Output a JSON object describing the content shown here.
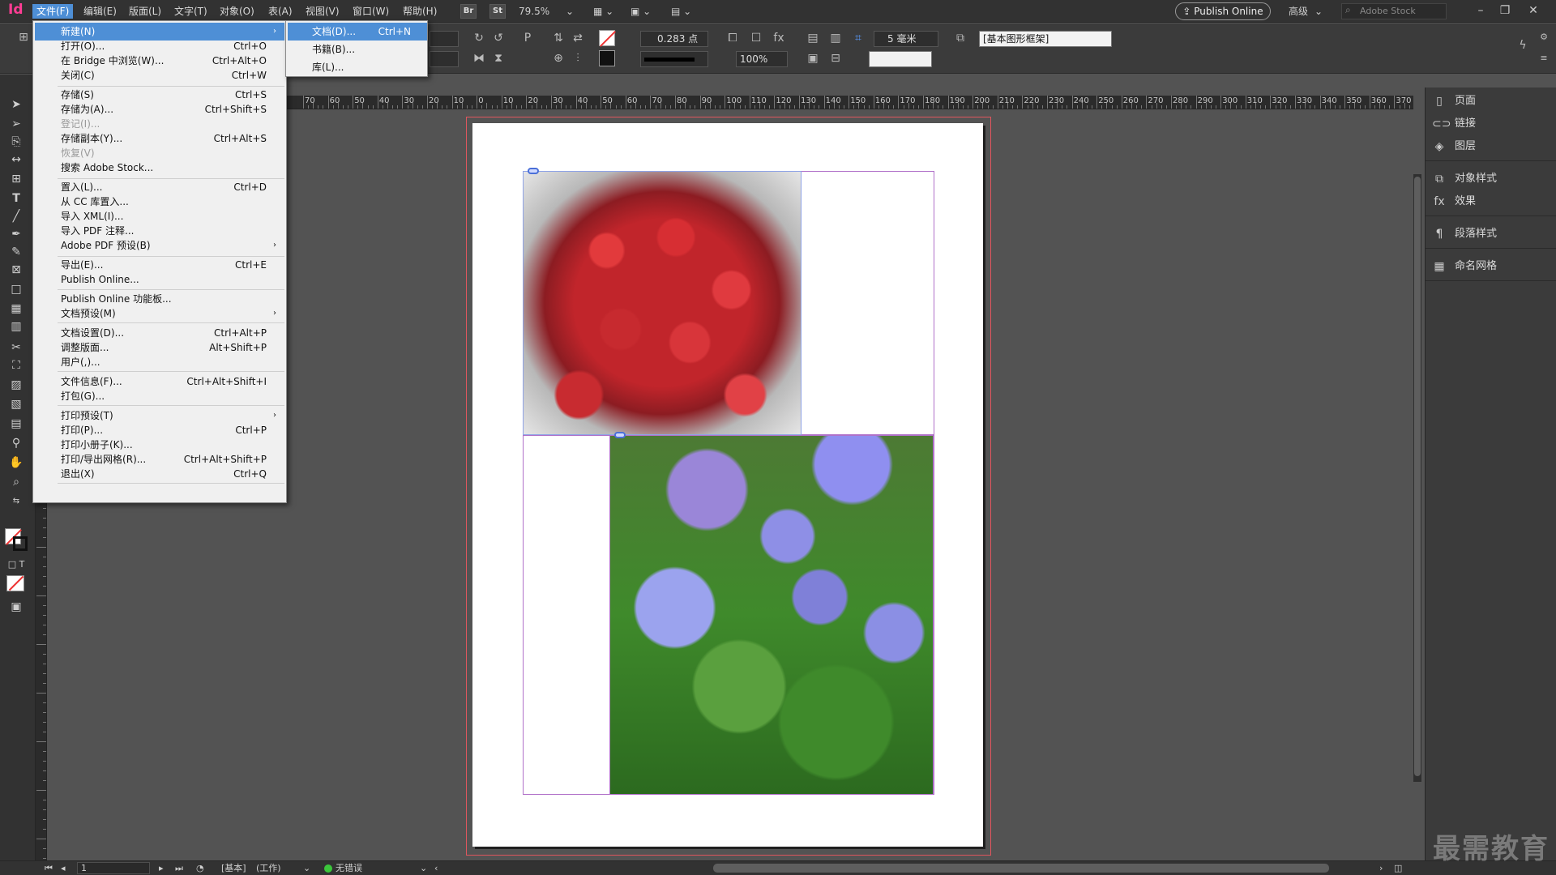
{
  "app": {
    "logo": "Id"
  },
  "menubar": {
    "items": [
      "文件(F)",
      "编辑(E)",
      "版面(L)",
      "文字(T)",
      "对象(O)",
      "表(A)",
      "视图(V)",
      "窗口(W)",
      "帮助(H)"
    ],
    "bridge": "Br",
    "stock": "St",
    "zoom": "79.5%",
    "publish_online": "Publish Online",
    "workspace": "高级",
    "search_placeholder": "Adobe Stock"
  },
  "controlbar": {
    "stroke_weight": "0.283 点",
    "zoom_pct": "100%",
    "gap": "5 毫米",
    "object_style": "[基本图形框架]"
  },
  "file_menu": {
    "items": [
      {
        "label": "新建(N)",
        "shortcut": "",
        "submenu": true,
        "disabled": false,
        "highlight": true
      },
      {
        "label": "打开(O)...",
        "shortcut": "Ctrl+O"
      },
      {
        "label": "在 Bridge 中浏览(W)...",
        "shortcut": "Ctrl+Alt+O"
      },
      {
        "label": "关闭(C)",
        "shortcut": "Ctrl+W"
      },
      {
        "label": "存储(S)",
        "shortcut": "Ctrl+S"
      },
      {
        "label": "存储为(A)...",
        "shortcut": "Ctrl+Shift+S"
      },
      {
        "label": "登记(I)...",
        "shortcut": "",
        "disabled": true
      },
      {
        "label": "存储副本(Y)...",
        "shortcut": "Ctrl+Alt+S"
      },
      {
        "label": "恢复(V)",
        "shortcut": "",
        "disabled": true
      },
      {
        "label": "搜索 Adobe Stock...",
        "shortcut": ""
      },
      {
        "label": "置入(L)...",
        "shortcut": "Ctrl+D"
      },
      {
        "label": "从 CC 库置入...",
        "shortcut": ""
      },
      {
        "label": "导入 XML(I)...",
        "shortcut": ""
      },
      {
        "label": "导入 PDF 注释...",
        "shortcut": ""
      },
      {
        "label": "Adobe PDF 预设(B)",
        "shortcut": "",
        "submenu": true
      },
      {
        "label": "导出(E)...",
        "shortcut": "Ctrl+E"
      },
      {
        "label": "Publish Online...",
        "shortcut": ""
      },
      {
        "label": "Publish Online 功能板...",
        "shortcut": ""
      },
      {
        "label": "文档预设(M)",
        "shortcut": "",
        "submenu": true
      },
      {
        "label": "文档设置(D)...",
        "shortcut": "Ctrl+Alt+P"
      },
      {
        "label": "调整版面...",
        "shortcut": "Alt+Shift+P"
      },
      {
        "label": "用户(,)...",
        "shortcut": ""
      },
      {
        "label": "文件信息(F)...",
        "shortcut": "Ctrl+Alt+Shift+I"
      },
      {
        "label": "打包(G)...",
        "shortcut": ""
      },
      {
        "label": "打印预设(T)",
        "shortcut": "",
        "submenu": true
      },
      {
        "label": "打印(P)...",
        "shortcut": "Ctrl+P"
      },
      {
        "label": "打印小册子(K)...",
        "shortcut": ""
      },
      {
        "label": "打印/导出网格(R)...",
        "shortcut": "Ctrl+Alt+Shift+P"
      },
      {
        "label": "退出(X)",
        "shortcut": "Ctrl+Q"
      }
    ]
  },
  "new_submenu": {
    "items": [
      {
        "label": "文档(D)...",
        "shortcut": "Ctrl+N",
        "highlight": true
      },
      {
        "label": "书籍(B)...",
        "shortcut": ""
      },
      {
        "label": "库(L)...",
        "shortcut": ""
      }
    ]
  },
  "ruler": {
    "labels": [
      "70",
      "60",
      "50",
      "40",
      "30",
      "20",
      "10",
      "0",
      "10",
      "20",
      "30",
      "40",
      "50",
      "60",
      "70",
      "80",
      "90",
      "100",
      "110",
      "120",
      "130",
      "140",
      "150",
      "160",
      "170",
      "180",
      "190",
      "200",
      "210",
      "220",
      "230",
      "240",
      "250",
      "260",
      "270",
      "280",
      "290",
      "300",
      "310",
      "320",
      "330",
      "340",
      "350",
      "360",
      "370",
      "38"
    ]
  },
  "right_panel": {
    "items": [
      "页面",
      "链接",
      "图层",
      "对象样式",
      "效果",
      "段落样式",
      "命名网格"
    ]
  },
  "statusbar": {
    "page": "1",
    "master": "[基本]",
    "mode": "(工作)",
    "preflight": "无错误"
  },
  "watermark": "最需教育",
  "colors": {
    "accent": "#4e8fd6",
    "bleed": "#e0565e",
    "frame": "#b071c9",
    "ok": "#3bc63b",
    "logo": "#ff3d94"
  }
}
